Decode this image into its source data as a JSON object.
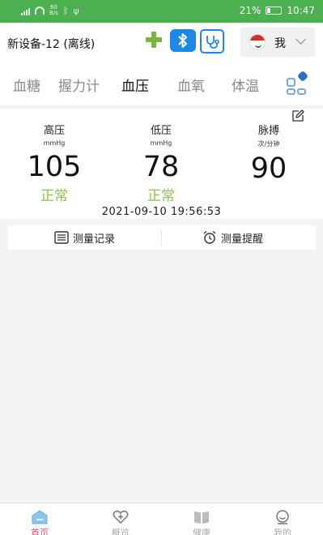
{
  "status_bar": {
    "network_speed": "60\nB/s",
    "battery": "21%",
    "time": "10:47"
  },
  "header": {
    "device_title": "新设备-12 (离线)",
    "me_label": "我"
  },
  "tabs": [
    {
      "label": "血糖",
      "active": false
    },
    {
      "label": "握力计",
      "active": false
    },
    {
      "label": "血压",
      "active": true
    },
    {
      "label": "血氧",
      "active": false
    },
    {
      "label": "体温",
      "active": false
    }
  ],
  "reading": {
    "systolic": {
      "name": "高压",
      "unit": "mmHg",
      "value": "105",
      "status": "正常"
    },
    "diastolic": {
      "name": "低压",
      "unit": "mmHg",
      "value": "78",
      "status": "正常"
    },
    "pulse": {
      "name": "脉搏",
      "unit": "次/分钟",
      "value": "90"
    },
    "timestamp": "2021-09-10 19:56:53"
  },
  "actions": {
    "records": "测量记录",
    "reminder": "测量提醒"
  },
  "nav": [
    {
      "label": "首页",
      "icon": "home-icon",
      "active": true
    },
    {
      "label": "概览",
      "icon": "heart-plus-icon",
      "active": false
    },
    {
      "label": "健康",
      "icon": "book-icon",
      "active": false
    },
    {
      "label": "我的",
      "icon": "profile-icon",
      "active": false
    }
  ],
  "colors": {
    "status_bar": "#4caf50",
    "accent_blue": "#1e88e5",
    "normal_green": "#8bc34a",
    "nav_active": "#e04a74"
  }
}
